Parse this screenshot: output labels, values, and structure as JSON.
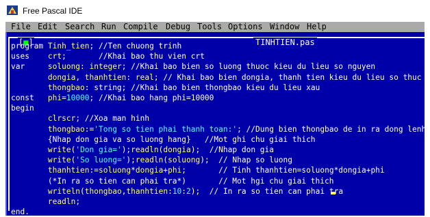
{
  "window": {
    "title": "Free Pascal IDE"
  },
  "menu": [
    "File",
    "Edit",
    "Search",
    "Run",
    "Compile",
    "Debug",
    "Tools",
    "Options",
    "Window",
    "Help"
  ],
  "editor": {
    "close_box": "[■]",
    "filename": "TINHTIEN.pas",
    "lines": [
      [
        [
          "w",
          "program "
        ],
        [
          "y",
          "Tinh_tien"
        ],
        [
          "w",
          "; //Ten chuong trinh"
        ]
      ],
      [
        [
          "w",
          "uses    "
        ],
        [
          "y",
          "crt"
        ],
        [
          "w",
          ";       //Khai bao thu vien crt"
        ]
      ],
      [
        [
          "w",
          "var     "
        ],
        [
          "y",
          "soluong"
        ],
        [
          "w",
          ": "
        ],
        [
          "y",
          "integer"
        ],
        [
          "w",
          "; //Khai bao bien so luong thuoc kieu du lieu so nguyen"
        ]
      ],
      [
        [
          "w",
          "        "
        ],
        [
          "y",
          "dongia"
        ],
        [
          "w",
          ", "
        ],
        [
          "y",
          "thanhtien"
        ],
        [
          "w",
          ": "
        ],
        [
          "y",
          "real"
        ],
        [
          "w",
          "; // Khai bao bien dongia, thanh tien kieu du lieu so thuc"
        ]
      ],
      [
        [
          "w",
          "        "
        ],
        [
          "y",
          "thongbao"
        ],
        [
          "w",
          ": string; //Khai bao bien thongbao kieu du lieu xau"
        ]
      ],
      [
        [
          "w",
          "const   "
        ],
        [
          "y",
          "phi"
        ],
        [
          "w",
          "="
        ],
        [
          "c",
          "10000"
        ],
        [
          "w",
          "; //Khai bao hang phi=10000"
        ]
      ],
      [
        [
          "w",
          "begin"
        ]
      ],
      [
        [
          "w",
          "        "
        ],
        [
          "y",
          "clrscr"
        ],
        [
          "w",
          "; //Xoa man hinh"
        ]
      ],
      [
        [
          "w",
          "        "
        ],
        [
          "y",
          "thongbao"
        ],
        [
          "w",
          ":="
        ],
        [
          "c",
          "'Tong so tien phai thanh toan:'"
        ],
        [
          "w",
          "; //Dung bien thongbao de in ra dong lenh"
        ]
      ],
      [
        [
          "w",
          "        {Nhap don gia va so luong hang}   //Mot ghi chu giai thich"
        ]
      ],
      [
        [
          "w",
          "        "
        ],
        [
          "y",
          "write"
        ],
        [
          "w",
          "("
        ],
        [
          "c",
          "'Don gia='"
        ],
        [
          "w",
          ");"
        ],
        [
          "y",
          "readln"
        ],
        [
          "w",
          "("
        ],
        [
          "y",
          "dongia"
        ],
        [
          "w",
          ");  //Nhap don gia"
        ]
      ],
      [
        [
          "w",
          "        "
        ],
        [
          "y",
          "write"
        ],
        [
          "w",
          "("
        ],
        [
          "c",
          "'So luong='"
        ],
        [
          "w",
          ");"
        ],
        [
          "y",
          "readln"
        ],
        [
          "w",
          "("
        ],
        [
          "y",
          "soluong"
        ],
        [
          "w",
          ");  // Nhap so luong"
        ]
      ],
      [
        [
          "w",
          "        "
        ],
        [
          "y",
          "thanhtien"
        ],
        [
          "w",
          ":="
        ],
        [
          "y",
          "soluong"
        ],
        [
          "w",
          "*"
        ],
        [
          "y",
          "dongia"
        ],
        [
          "w",
          "+"
        ],
        [
          "y",
          "phi"
        ],
        [
          "w",
          ";       // Tinh thanhtien=soluong*dongia+phi"
        ]
      ],
      [
        [
          "w",
          "        (*In ra so tien can phai tra*)       // Mot hgi chu giai thich"
        ]
      ],
      [
        [
          "w",
          "        "
        ],
        [
          "y",
          "writeln"
        ],
        [
          "w",
          "("
        ],
        [
          "y",
          "thongbao"
        ],
        [
          "w",
          ","
        ],
        [
          "y",
          "thanhtien"
        ],
        [
          "w",
          ":"
        ],
        [
          "c",
          "10"
        ],
        [
          "w",
          ":"
        ],
        [
          "c",
          "2"
        ],
        [
          "w",
          ");  // In ra so tien can phai tra"
        ]
      ],
      [
        [
          "w",
          "        "
        ],
        [
          "y",
          "readln"
        ],
        [
          "w",
          ";"
        ]
      ],
      [
        [
          "w",
          "end."
        ]
      ]
    ]
  }
}
